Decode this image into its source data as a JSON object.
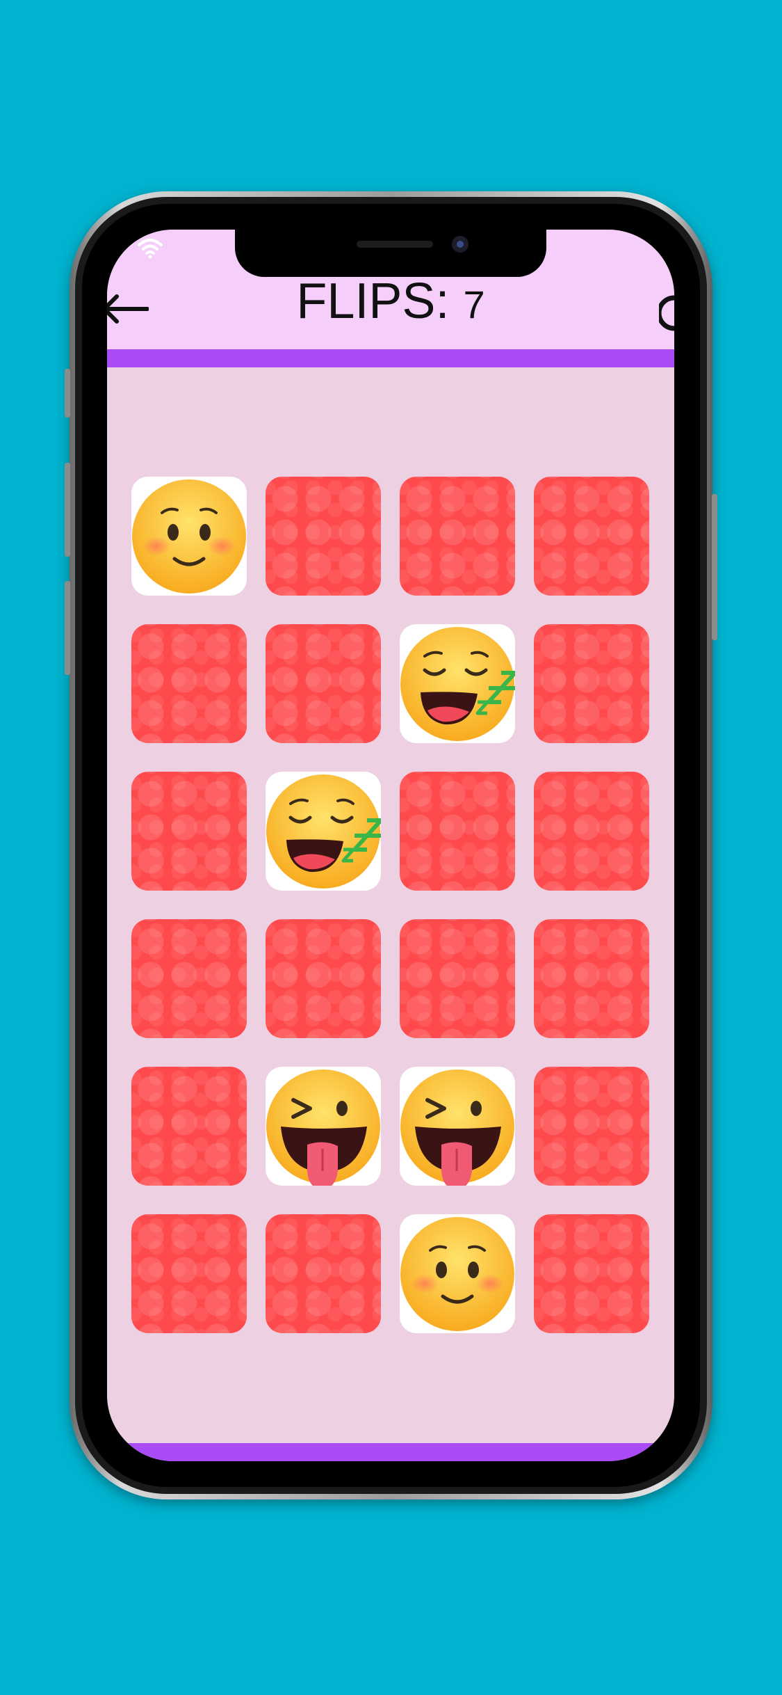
{
  "header": {
    "title_label": "FLIPS:",
    "flip_count": "7",
    "back_icon": "arrow-left-icon",
    "reset_icon": "reset-icon",
    "wifi_icon": "wifi-icon"
  },
  "colors": {
    "background": "#00b3cf",
    "header": "#f5cefa",
    "accent_bar": "#a94bf6",
    "board": "#edd0e1",
    "card_back": "#fe4a4c",
    "card_face": "#ffffff"
  },
  "board": {
    "columns": 4,
    "rows": 6,
    "cards": [
      {
        "state": "face",
        "emoji": "smiling-blush-face"
      },
      {
        "state": "back"
      },
      {
        "state": "back"
      },
      {
        "state": "back"
      },
      {
        "state": "back"
      },
      {
        "state": "back"
      },
      {
        "state": "face",
        "emoji": "sleeping-face"
      },
      {
        "state": "back"
      },
      {
        "state": "back"
      },
      {
        "state": "face",
        "emoji": "sleeping-face"
      },
      {
        "state": "back"
      },
      {
        "state": "back"
      },
      {
        "state": "back"
      },
      {
        "state": "back"
      },
      {
        "state": "back"
      },
      {
        "state": "back"
      },
      {
        "state": "back"
      },
      {
        "state": "face",
        "emoji": "winking-tongue-face"
      },
      {
        "state": "face",
        "emoji": "winking-tongue-face"
      },
      {
        "state": "back"
      },
      {
        "state": "back"
      },
      {
        "state": "back"
      },
      {
        "state": "face",
        "emoji": "smiling-blush-face"
      },
      {
        "state": "back"
      }
    ]
  }
}
